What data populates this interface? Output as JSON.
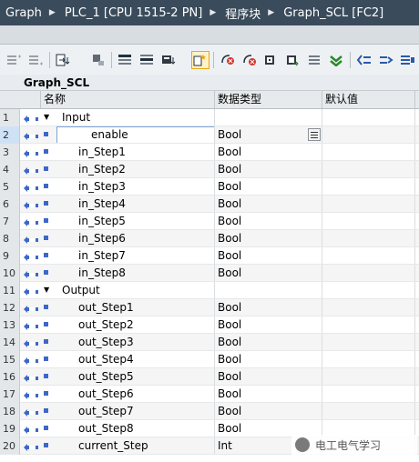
{
  "breadcrumb": [
    "Graph",
    "PLC_1 [CPU 1515-2 PN]",
    "程序块",
    "Graph_SCL [FC2]"
  ],
  "block_title": "Graph_SCL",
  "columns": {
    "name": "名称",
    "datatype": "数据类型",
    "default": "默认值"
  },
  "sections": {
    "input": "Input",
    "output": "Output"
  },
  "rows": [
    {
      "n": "1",
      "name": "Input",
      "type": "",
      "kind": "section"
    },
    {
      "n": "2",
      "name": "enable",
      "type": "Bool",
      "kind": "var",
      "editing": true
    },
    {
      "n": "3",
      "name": "in_Step1",
      "type": "Bool",
      "kind": "var"
    },
    {
      "n": "4",
      "name": "in_Step2",
      "type": "Bool",
      "kind": "var"
    },
    {
      "n": "5",
      "name": "in_Step3",
      "type": "Bool",
      "kind": "var"
    },
    {
      "n": "6",
      "name": "in_Step4",
      "type": "Bool",
      "kind": "var"
    },
    {
      "n": "7",
      "name": "in_Step5",
      "type": "Bool",
      "kind": "var"
    },
    {
      "n": "8",
      "name": "in_Step6",
      "type": "Bool",
      "kind": "var"
    },
    {
      "n": "9",
      "name": "in_Step7",
      "type": "Bool",
      "kind": "var"
    },
    {
      "n": "10",
      "name": "in_Step8",
      "type": "Bool",
      "kind": "var"
    },
    {
      "n": "11",
      "name": "Output",
      "type": "",
      "kind": "section"
    },
    {
      "n": "12",
      "name": "out_Step1",
      "type": "Bool",
      "kind": "var"
    },
    {
      "n": "13",
      "name": "out_Step2",
      "type": "Bool",
      "kind": "var"
    },
    {
      "n": "14",
      "name": "out_Step3",
      "type": "Bool",
      "kind": "var"
    },
    {
      "n": "15",
      "name": "out_Step4",
      "type": "Bool",
      "kind": "var"
    },
    {
      "n": "16",
      "name": "out_Step5",
      "type": "Bool",
      "kind": "var"
    },
    {
      "n": "17",
      "name": "out_Step6",
      "type": "Bool",
      "kind": "var"
    },
    {
      "n": "18",
      "name": "out_Step7",
      "type": "Bool",
      "kind": "var"
    },
    {
      "n": "19",
      "name": "out_Step8",
      "type": "Bool",
      "kind": "var"
    },
    {
      "n": "20",
      "name": "current_Step",
      "type": "Int",
      "kind": "var"
    }
  ],
  "toolbar_icons": [
    "insert-row-icon",
    "add-row-icon",
    "download-icon",
    "monitor-icon",
    "collapse-icon",
    "expand-icon",
    "snapshot-icon",
    "compare-icon",
    "breakpoint-icon",
    "delete-breakpoint-icon",
    "step-icon",
    "step-over-icon",
    "list-icon",
    "go-to-icon",
    "indent-icon",
    "outdent-icon",
    "comment-icon"
  ],
  "watermark": "电工电气学习",
  "colors": {
    "titlebar": "#3a4b5b",
    "selected_row_number": "#cfe2f5",
    "var_marker": "#3b68c7"
  }
}
